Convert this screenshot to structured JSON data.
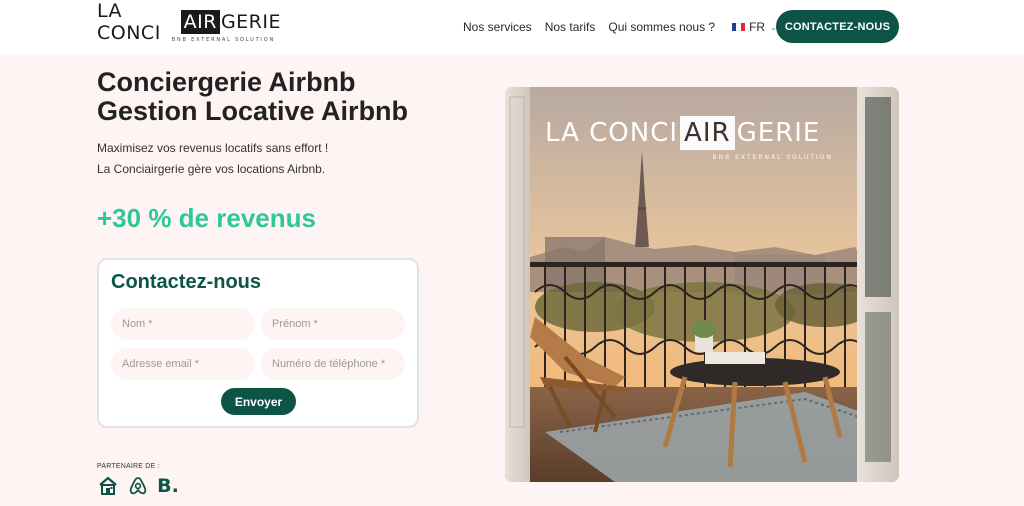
{
  "header": {
    "logo": {
      "pre": "LA CONCI",
      "air": "AIR",
      "post": "GERIE",
      "tagline": "BNB EXTERNAL SOLUTION"
    },
    "nav": [
      {
        "label": "Nos services"
      },
      {
        "label": "Nos tarifs"
      },
      {
        "label": "Qui sommes nous ?"
      }
    ],
    "lang": {
      "code": "FR",
      "flag_colors": [
        "#1f3f9a",
        "#ffffff",
        "#e3262f"
      ],
      "icon": "chevron-down-icon"
    },
    "cta_label": "CONTACTEZ-NOUS"
  },
  "hero": {
    "title_line1": "Conciergerie Airbnb",
    "title_line2": "Gestion Locative Airbnb",
    "subtitle_line1": "Maximisez vos revenus locatifs sans effort !",
    "subtitle_line2": "La Conciairgerie gère vos locations Airbnb.",
    "revenue": "+30 % de revenus"
  },
  "form": {
    "title": "Contactez-nous",
    "fields": {
      "nom": {
        "placeholder": "Nom *",
        "value": ""
      },
      "prenom": {
        "placeholder": "Prénom *",
        "value": ""
      },
      "email": {
        "placeholder": "Adresse email *",
        "value": ""
      },
      "phone": {
        "placeholder": "Numéro de téléphone *",
        "value": ""
      }
    },
    "submit_label": "Envoyer"
  },
  "partners": {
    "label": "PARTENAIRE DE :",
    "items": [
      {
        "icon": "house-icon"
      },
      {
        "icon": "airbnb-icon"
      },
      {
        "icon": "booking-icon",
        "text": "B."
      }
    ]
  },
  "image": {
    "logo": {
      "pre": "LA CONCI",
      "air": "AIR",
      "post": "GERIE",
      "tagline": "BNB EXTERNAL SOLUTION"
    }
  },
  "colors": {
    "primary": "#0d5447",
    "accent": "#2fc79c",
    "background": "#fdf4f3"
  }
}
